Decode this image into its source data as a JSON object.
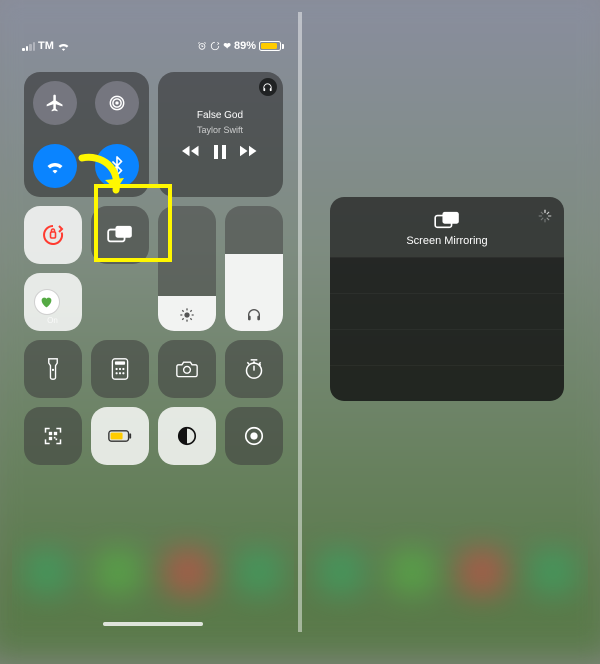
{
  "status": {
    "carrier": "TM",
    "battery_pct": "89%"
  },
  "music": {
    "song": "False God",
    "artist": "Taylor Swift"
  },
  "focus": {
    "state_label": "On"
  },
  "brightness": {
    "level_pct": 28
  },
  "volume": {
    "level_pct": 62
  },
  "screen_mirroring": {
    "title": "Screen Mirroring"
  },
  "colors": {
    "highlight": "#fff700",
    "accent_blue": "#0a84ff",
    "battery_low_power": "#ffcc00"
  }
}
